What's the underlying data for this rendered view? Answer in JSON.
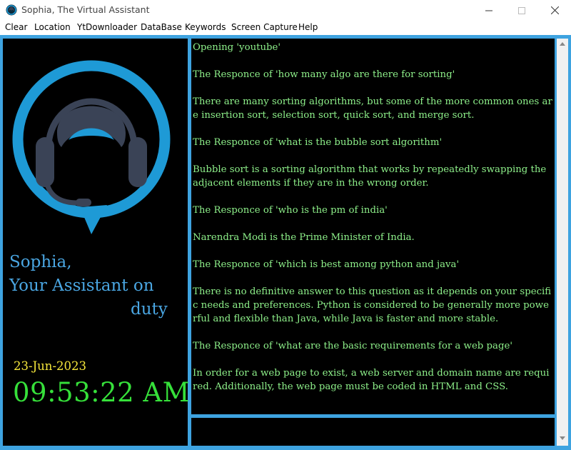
{
  "window": {
    "title": "Sophia, The Virtual Assistant"
  },
  "menu": {
    "items": [
      "Clear",
      "Location",
      "YtDownloader",
      "DataBase",
      "Keywords",
      "Screen Capture",
      "Help"
    ]
  },
  "assistant": {
    "greeting_line1": "Sophia,",
    "greeting_line2": "Your Assistant on",
    "greeting_line3": "duty",
    "date": "23-Jun-2023",
    "time": "09:53:22 AM"
  },
  "log": {
    "lines": [
      "Opening 'youtube'",
      "",
      "The Responce of 'how many algo are there for sorting'",
      "",
      "There are many sorting algorithms, but some of the more common ones are insertion sort, selection sort, quick sort, and merge sort.",
      "",
      "The Responce of 'what is the bubble sort algorithm'",
      "",
      "Bubble sort is a sorting algorithm that works by repeatedly swapping the adjacent elements if they are in the wrong order.",
      "",
      "The Responce of 'who is the pm of india'",
      "",
      "Narendra Modi is the Prime Minister of India.",
      "",
      "The Responce of 'which is best among python and java'",
      "",
      "There is no definitive answer to this question as it depends on your specific needs and preferences. Python is considered to be generally more powerful and flexible than Java, while Java is faster and more stable.",
      "",
      "The Responce of 'what are the basic requirements for a web page'",
      "",
      "In order for a web page to exist, a web server and domain name are required. Additionally, the web page must be coded in HTML and CSS."
    ]
  },
  "input": {
    "value": ""
  },
  "colors": {
    "accent": "#3ea3e0",
    "panel_bg": "#000000",
    "greeting": "#4aa6e2",
    "date": "#f5e63b",
    "clock": "#36e03a",
    "log_text": "#8ef08a",
    "logo_blue": "#1e9ad6",
    "logo_gray": "#3a4356"
  },
  "icons": {
    "app": "headset-app-icon",
    "minimize": "minimize-icon",
    "maximize": "maximize-icon",
    "close": "close-icon",
    "logo": "headset-assistant-logo"
  }
}
